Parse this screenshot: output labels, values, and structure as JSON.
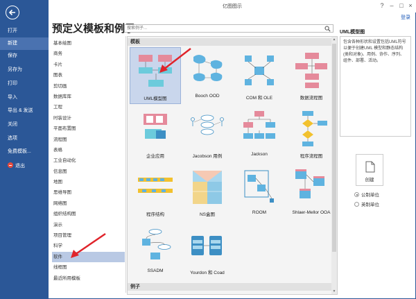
{
  "window": {
    "title": "亿图图示",
    "login": "登录"
  },
  "nav": {
    "items": [
      "打开",
      "新建",
      "保存",
      "另存为",
      "打印",
      "导入",
      "导出 & 发送",
      "关闭",
      "选项",
      "免费模板...",
      "退出"
    ],
    "active_index": 1
  },
  "heading": "预定义模板和例子",
  "search": {
    "placeholder": "搜索例子..."
  },
  "categories": {
    "items": [
      "基本绘图",
      "商务",
      "卡片",
      "图表",
      "剪切画",
      "数据库库",
      "工程",
      "时装设计",
      "平面布置图",
      "流程图",
      "表格",
      "工业自动化",
      "信息图",
      "地图",
      "思维导图",
      "网络图",
      "组织结构图",
      "演示",
      "项目管理",
      "科学",
      "软件",
      "线框图",
      "最近所用模板"
    ],
    "selected_index": 20
  },
  "templates": {
    "section_title": "模板",
    "examples_title": "例子",
    "items": [
      "UML模型图",
      "Booch OOD",
      "COM 和 OLE",
      "数据流程图",
      "企业应用",
      "Jacobson 用例",
      "Jackson",
      "程序流程图",
      "程序结构",
      "NS盒图",
      "ROOM",
      "Shlaer-Mellor OOA",
      "SSADM",
      "Yourdon 和 Coad"
    ],
    "selected_index": 0
  },
  "details": {
    "title": "UML模型图",
    "description": "包含各种形状和设置包括UML符号以便于创建UML 模型和静态结构(类和对象)、用例、协作、序列、组件、部署、活动。",
    "create_label": "创建",
    "units": [
      "公制单位",
      "英制单位"
    ],
    "unit_selected": 0
  },
  "colors": {
    "nav_bg": "#2b5797",
    "selected": "#b9c9e4",
    "arrow": "#e0242b"
  }
}
